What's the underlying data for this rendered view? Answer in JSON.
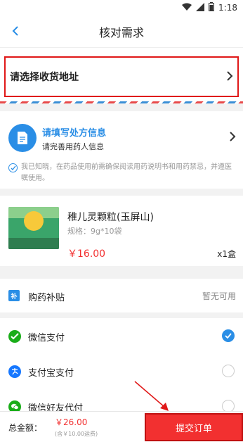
{
  "status_bar": {
    "time": "1:18"
  },
  "nav": {
    "title": "核对需求"
  },
  "address": {
    "label": "请选择收货地址"
  },
  "prescription": {
    "title": "请填写处方信息",
    "subtitle": "请完善用药人信息",
    "note": "我已知晓，在药品使用前需确保阅读用药说明书和用药禁忌，并遵医嘱使用。"
  },
  "product": {
    "name": "稚儿灵颗粒(玉屏山)",
    "spec": "规格：9g*10袋",
    "price": "￥16.00",
    "quantity": "x1盒"
  },
  "subsidy": {
    "icon_text": "补",
    "label": "购药补贴",
    "value": "暂无可用"
  },
  "payments": [
    {
      "label": "微信支付",
      "icon_color": "#1aad19",
      "selected": true
    },
    {
      "label": "支付宝支付",
      "icon_color": "#1677ff",
      "selected": false
    },
    {
      "label": "微信好友代付",
      "icon_color": "#1aad19",
      "selected": false
    }
  ],
  "footer": {
    "total_label": "总金额：",
    "total_price": "￥26.00",
    "shipping": "(含￥10.00运费)",
    "submit_label": "提交订单"
  },
  "colors": {
    "accent": "#2a8ee6",
    "price": "#f23030",
    "highlight_border": "#e01818"
  }
}
